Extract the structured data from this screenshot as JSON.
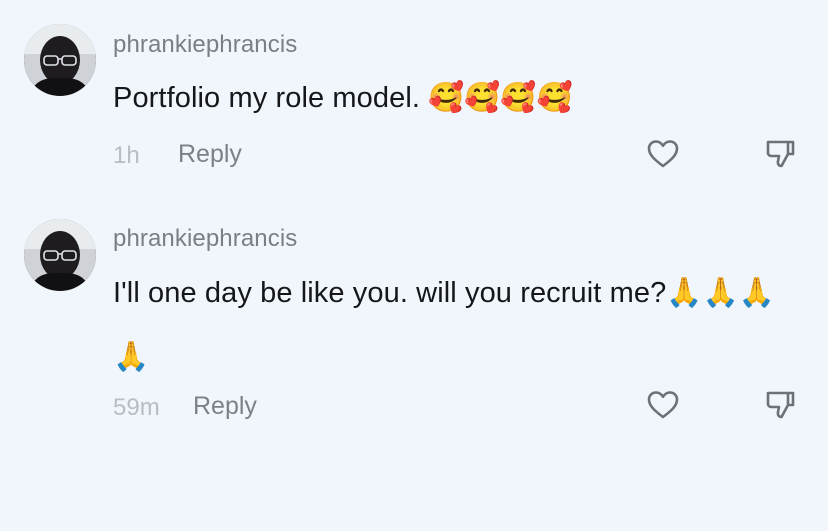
{
  "comments": [
    {
      "username": "phrankiephrancis",
      "text": "Portfolio my role model. ",
      "emojis": "🥰🥰🥰🥰",
      "time": "1h",
      "reply_label": "Reply"
    },
    {
      "username": "phrankiephrancis",
      "text": "I'll one day be like you. will you recruit me?",
      "emojis": "🙏🙏🙏🙏",
      "time": "59m",
      "reply_label": "Reply"
    }
  ],
  "icons": {
    "like": "heart-outline-icon",
    "dislike": "thumbs-down-outline-icon"
  },
  "colors": {
    "background": "#f1f6fc",
    "text": "#15171a",
    "username": "#7a7f86",
    "time": "#b9bdc2",
    "icon": "#6c7178"
  }
}
